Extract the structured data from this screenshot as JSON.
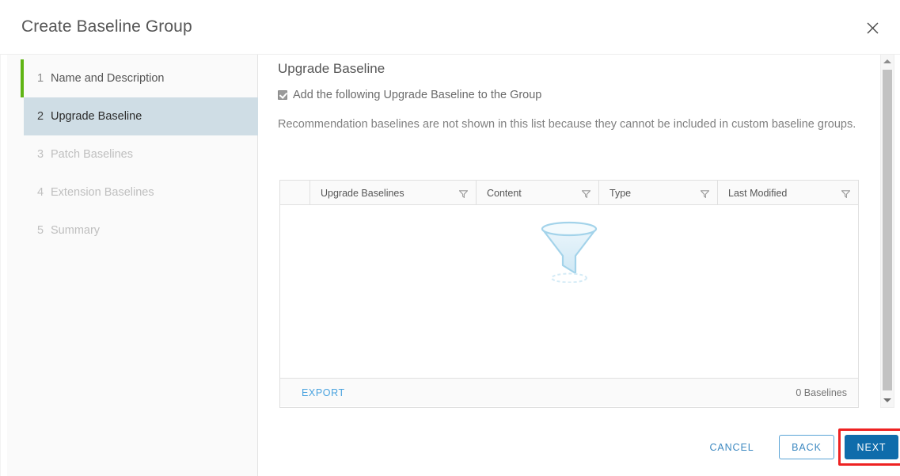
{
  "dialog": {
    "title": "Create Baseline Group",
    "close_icon": "close-icon"
  },
  "sidebar": {
    "steps": [
      {
        "num": "1",
        "label": "Name and Description",
        "state": "done"
      },
      {
        "num": "2",
        "label": "Upgrade Baseline",
        "state": "active"
      },
      {
        "num": "3",
        "label": "Patch Baselines",
        "state": "disabled"
      },
      {
        "num": "4",
        "label": "Extension Baselines",
        "state": "disabled"
      },
      {
        "num": "5",
        "label": "Summary",
        "state": "disabled"
      }
    ]
  },
  "main": {
    "pane_title": "Upgrade Baseline",
    "checkbox_label": "Add the following Upgrade Baseline to the Group",
    "checkbox_checked": true,
    "description": "Recommendation baselines are not shown in this list because they cannot be included in custom baseline groups.",
    "table": {
      "columns": [
        {
          "label": "",
          "key": "select"
        },
        {
          "label": "Upgrade Baselines",
          "key": "name"
        },
        {
          "label": "Content",
          "key": "content"
        },
        {
          "label": "Type",
          "key": "type"
        },
        {
          "label": "Last Modified",
          "key": "modified"
        }
      ],
      "rows": [],
      "empty_icon": "funnel-icon",
      "export_label": "EXPORT",
      "row_count_label": "0 Baselines"
    }
  },
  "footer": {
    "cancel_label": "CANCEL",
    "back_label": "BACK",
    "next_label": "NEXT",
    "highlight_color": "#ee2222"
  },
  "scrollbar": {
    "up_icon": "chevron-up-icon",
    "down_icon": "chevron-down-icon"
  },
  "colors": {
    "accent": "#0f6cab",
    "link": "#4aa3df",
    "step_marker": "#60b515",
    "active_step_bg": "#cfdde5"
  }
}
